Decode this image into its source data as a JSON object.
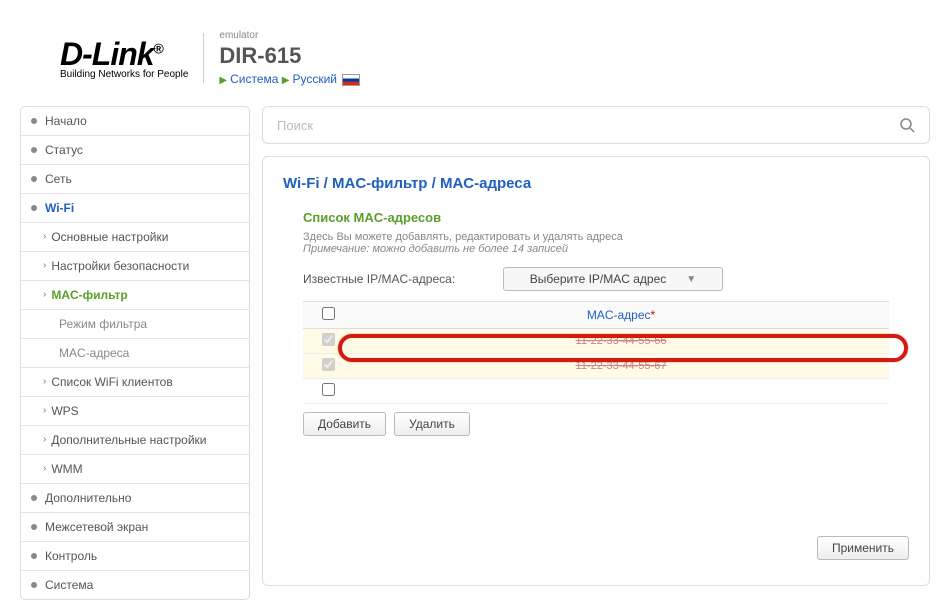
{
  "header": {
    "brand": "D-Link",
    "reg": "®",
    "tagline": "Building Networks for People",
    "emulator": "emulator",
    "model": "DIR-615",
    "crumb_system": "Система",
    "crumb_lang": "Русский"
  },
  "search": {
    "placeholder": "Поиск"
  },
  "nav": {
    "start": "Начало",
    "status": "Статус",
    "net": "Сеть",
    "wifi": "Wi-Fi",
    "wifi_basic": "Основные настройки",
    "wifi_sec": "Настройки безопасности",
    "wifi_mac": "MAC-фильтр",
    "wifi_mac_mode": "Режим фильтра",
    "wifi_mac_addr": "MAC-адреса",
    "wifi_clients": "Список WiFi клиентов",
    "wifi_wps": "WPS",
    "wifi_adv": "Дополнительные настройки",
    "wifi_wmm": "WMM",
    "additional": "Дополнительно",
    "firewall": "Межсетевой экран",
    "control": "Контроль",
    "system": "Система"
  },
  "main": {
    "breadcrumb": "Wi-Fi /  MAC-фильтр /  MAC-адреса",
    "section_title": "Список MAC-адресов",
    "desc": "Здесь Вы можете добавлять, редактировать и удалять адреса",
    "note": "Примечание: можно добавить не более 14 записей",
    "known_label": "Известные IP/MAC-адреса:",
    "dropdown": "Выберите IP/MAC адрес",
    "col_mac": "MAC-адрес",
    "rows": [
      {
        "mac": "11-22-33-44-55-66",
        "struck": true
      },
      {
        "mac": "11-22-33-44-55-67",
        "struck": true
      },
      {
        "mac": "",
        "struck": false
      }
    ],
    "btn_add": "Добавить",
    "btn_del": "Удалить",
    "btn_apply": "Применить"
  }
}
